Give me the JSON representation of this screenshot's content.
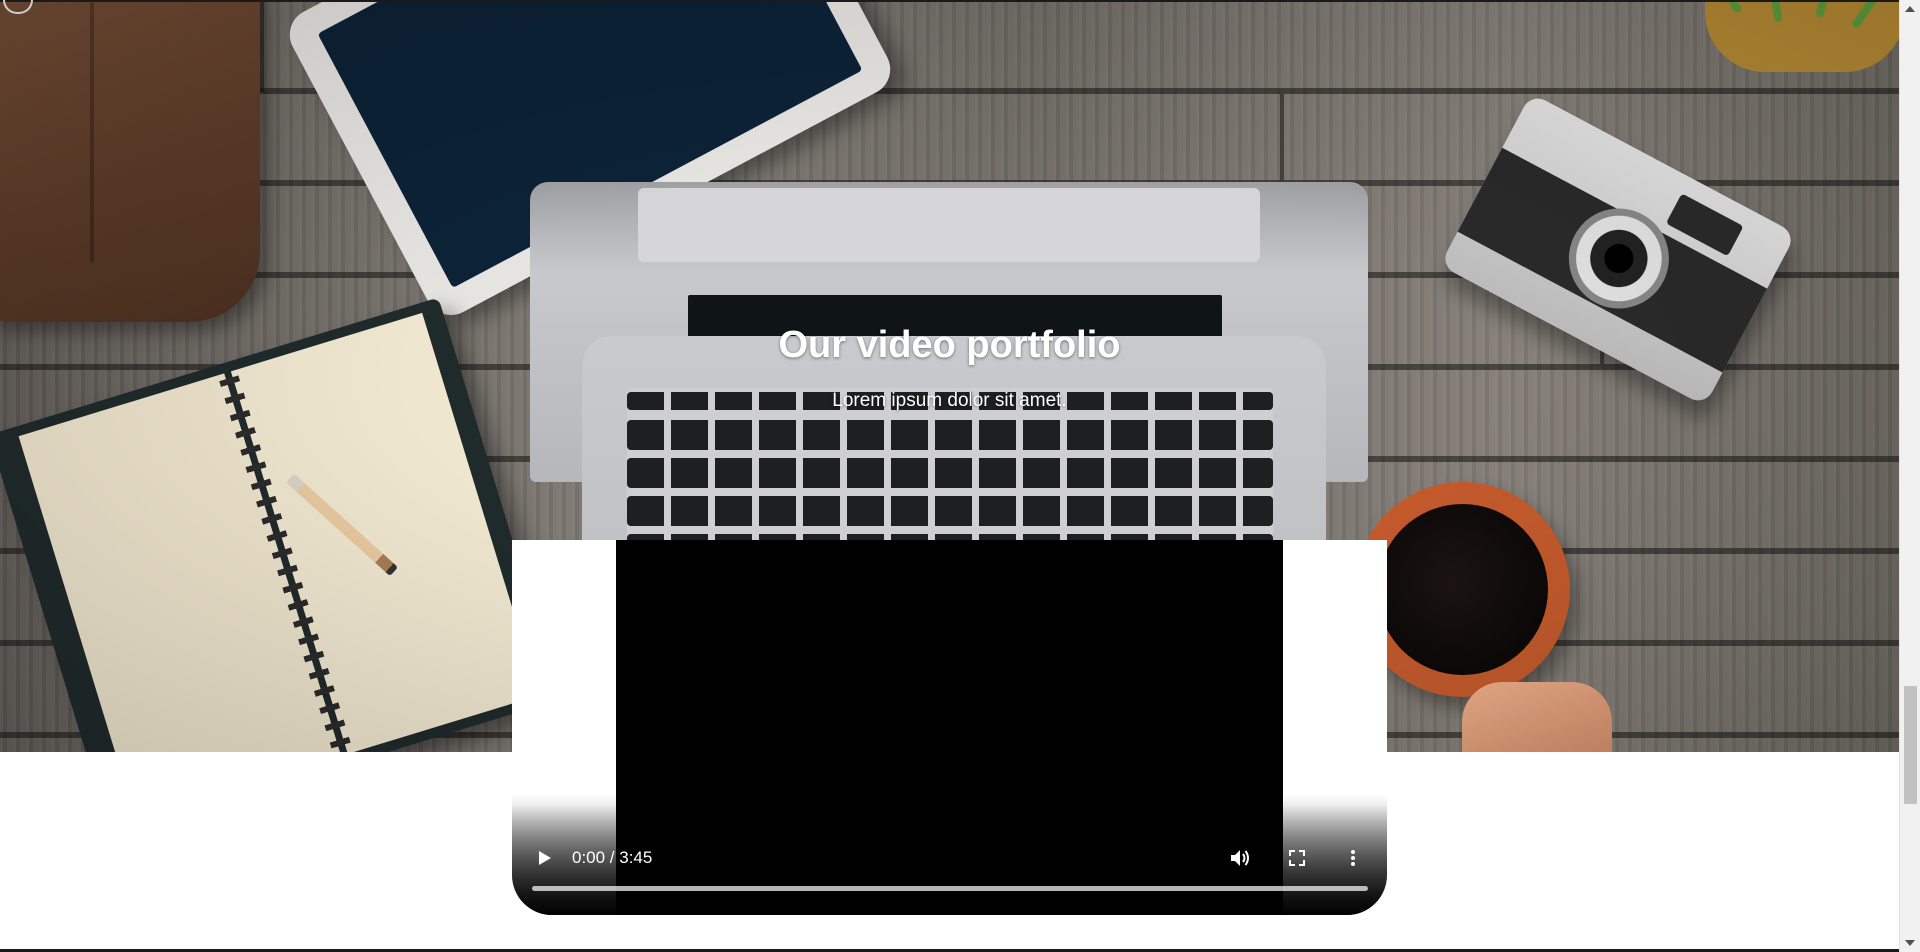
{
  "hero": {
    "title": "Our video portfolio",
    "subtitle": "Lorem ipsum dolor sit amet.",
    "background_image": "workspace desk with laptop, tablet, notebook, camera and coffee"
  },
  "video_player": {
    "time_display": "0:00 / 3:45",
    "current_time": "0:00",
    "duration": "3:45",
    "progress": 0,
    "icons": {
      "play": "play-icon",
      "mute": "volume-icon",
      "fullscreen": "fullscreen-icon",
      "more": "more-options-icon"
    }
  },
  "colors": {
    "title_text": "#ffffff",
    "video_background": "#000000",
    "page_background": "#ffffff",
    "scrollbar_thumb": "#c1c1c1"
  }
}
